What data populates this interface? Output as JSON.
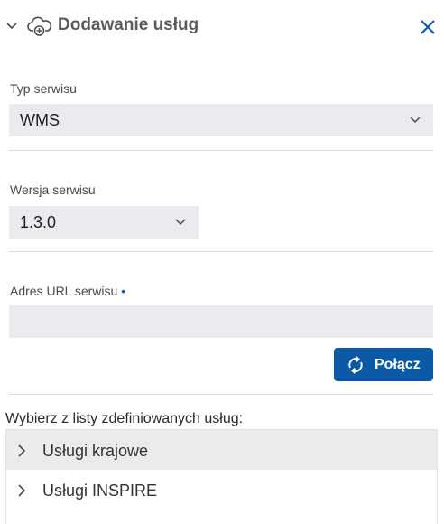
{
  "header": {
    "title": "Dodawanie usług",
    "collapse_icon": "chevron-down-icon",
    "title_icon": "cloud-add-icon",
    "close_icon": "close-icon"
  },
  "service_type": {
    "label": "Typ serwisu",
    "value": "WMS"
  },
  "service_version": {
    "label": "Wersja serwisu",
    "value": "1.3.0"
  },
  "service_url": {
    "label": "Adres URL serwisu",
    "required_marker": "•",
    "value": ""
  },
  "connect_button": {
    "label": "Połącz",
    "icon": "refresh-icon"
  },
  "predefined": {
    "title": "Wybierz z listy zdefiniowanych usług:",
    "items": [
      {
        "label": "Usługi krajowe"
      },
      {
        "label": "Usługi INSPIRE"
      }
    ]
  },
  "colors": {
    "accent": "#0c5aa6",
    "field_bg": "#e9ebee",
    "hover_row": "#ebebeb"
  }
}
